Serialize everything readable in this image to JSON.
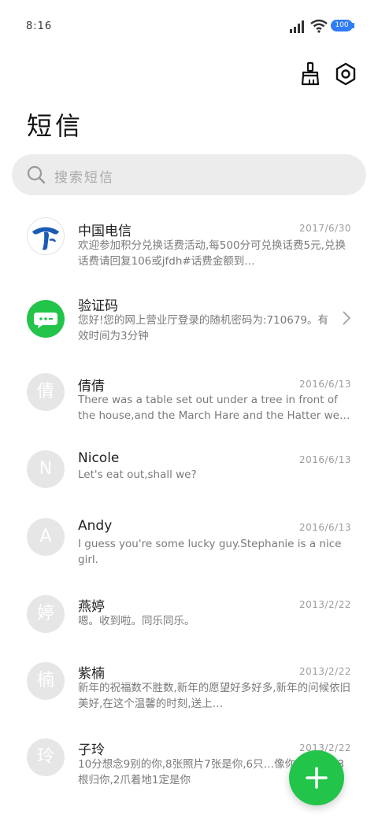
{
  "status_bar": {
    "time": "8:16",
    "battery": "100"
  },
  "header": {
    "title": "短信",
    "clean_icon": "broom-icon",
    "settings_icon": "gear-icon"
  },
  "search": {
    "placeholder": "搜索短信"
  },
  "messages": [
    {
      "name": "中国电信",
      "date": "2017/6/30",
      "preview": "欢迎参加积分兑换话费活动,每500分可兑换话费5元,兑换话费请回复106或jfdh#话费金额到…",
      "avatar": "china-telecom-logo"
    },
    {
      "name": "验证码",
      "date": "",
      "preview": "您好!您的网上营业厅登录的随机密码为:710679。有效时间为3分钟",
      "avatar": "message-bubble-icon"
    },
    {
      "name": "倩倩",
      "date": "2016/6/13",
      "preview": "There was a table set out under a tree in front of the house,and the March Hare and the Hatter were …",
      "avatar_letter": "倩"
    },
    {
      "name": "Nicole",
      "date": "2016/6/13",
      "preview": "Let's eat out,shall we?",
      "avatar_letter": "N"
    },
    {
      "name": "Andy",
      "date": "2016/6/13",
      "preview": "I guess you're some lucky guy.Stephanie is a nice girl.",
      "avatar_letter": "A"
    },
    {
      "name": "燕婷",
      "date": "2013/2/22",
      "preview": "嗯。收到啦。同乐同乐。",
      "avatar_letter": "婷"
    },
    {
      "name": "紫楠",
      "date": "2013/2/22",
      "preview": "新年的祝福数不胜数,新年的愿望好多好多,新年的问候依旧美好,在这个温馨的时刻,送上…",
      "avatar_letter": "楠"
    },
    {
      "name": "子玲",
      "date": "2013/2/22",
      "preview": "10分想念9别的你,8张照片7张是你,6只…像你,4根骨头3根归你,2爪着地1定是你",
      "avatar_letter": "玲"
    }
  ],
  "fab": {
    "icon": "plus-icon"
  },
  "colors": {
    "accent": "#22c44a",
    "battery": "#2f7cf6",
    "telecom_blue": "#1a5bb5"
  }
}
